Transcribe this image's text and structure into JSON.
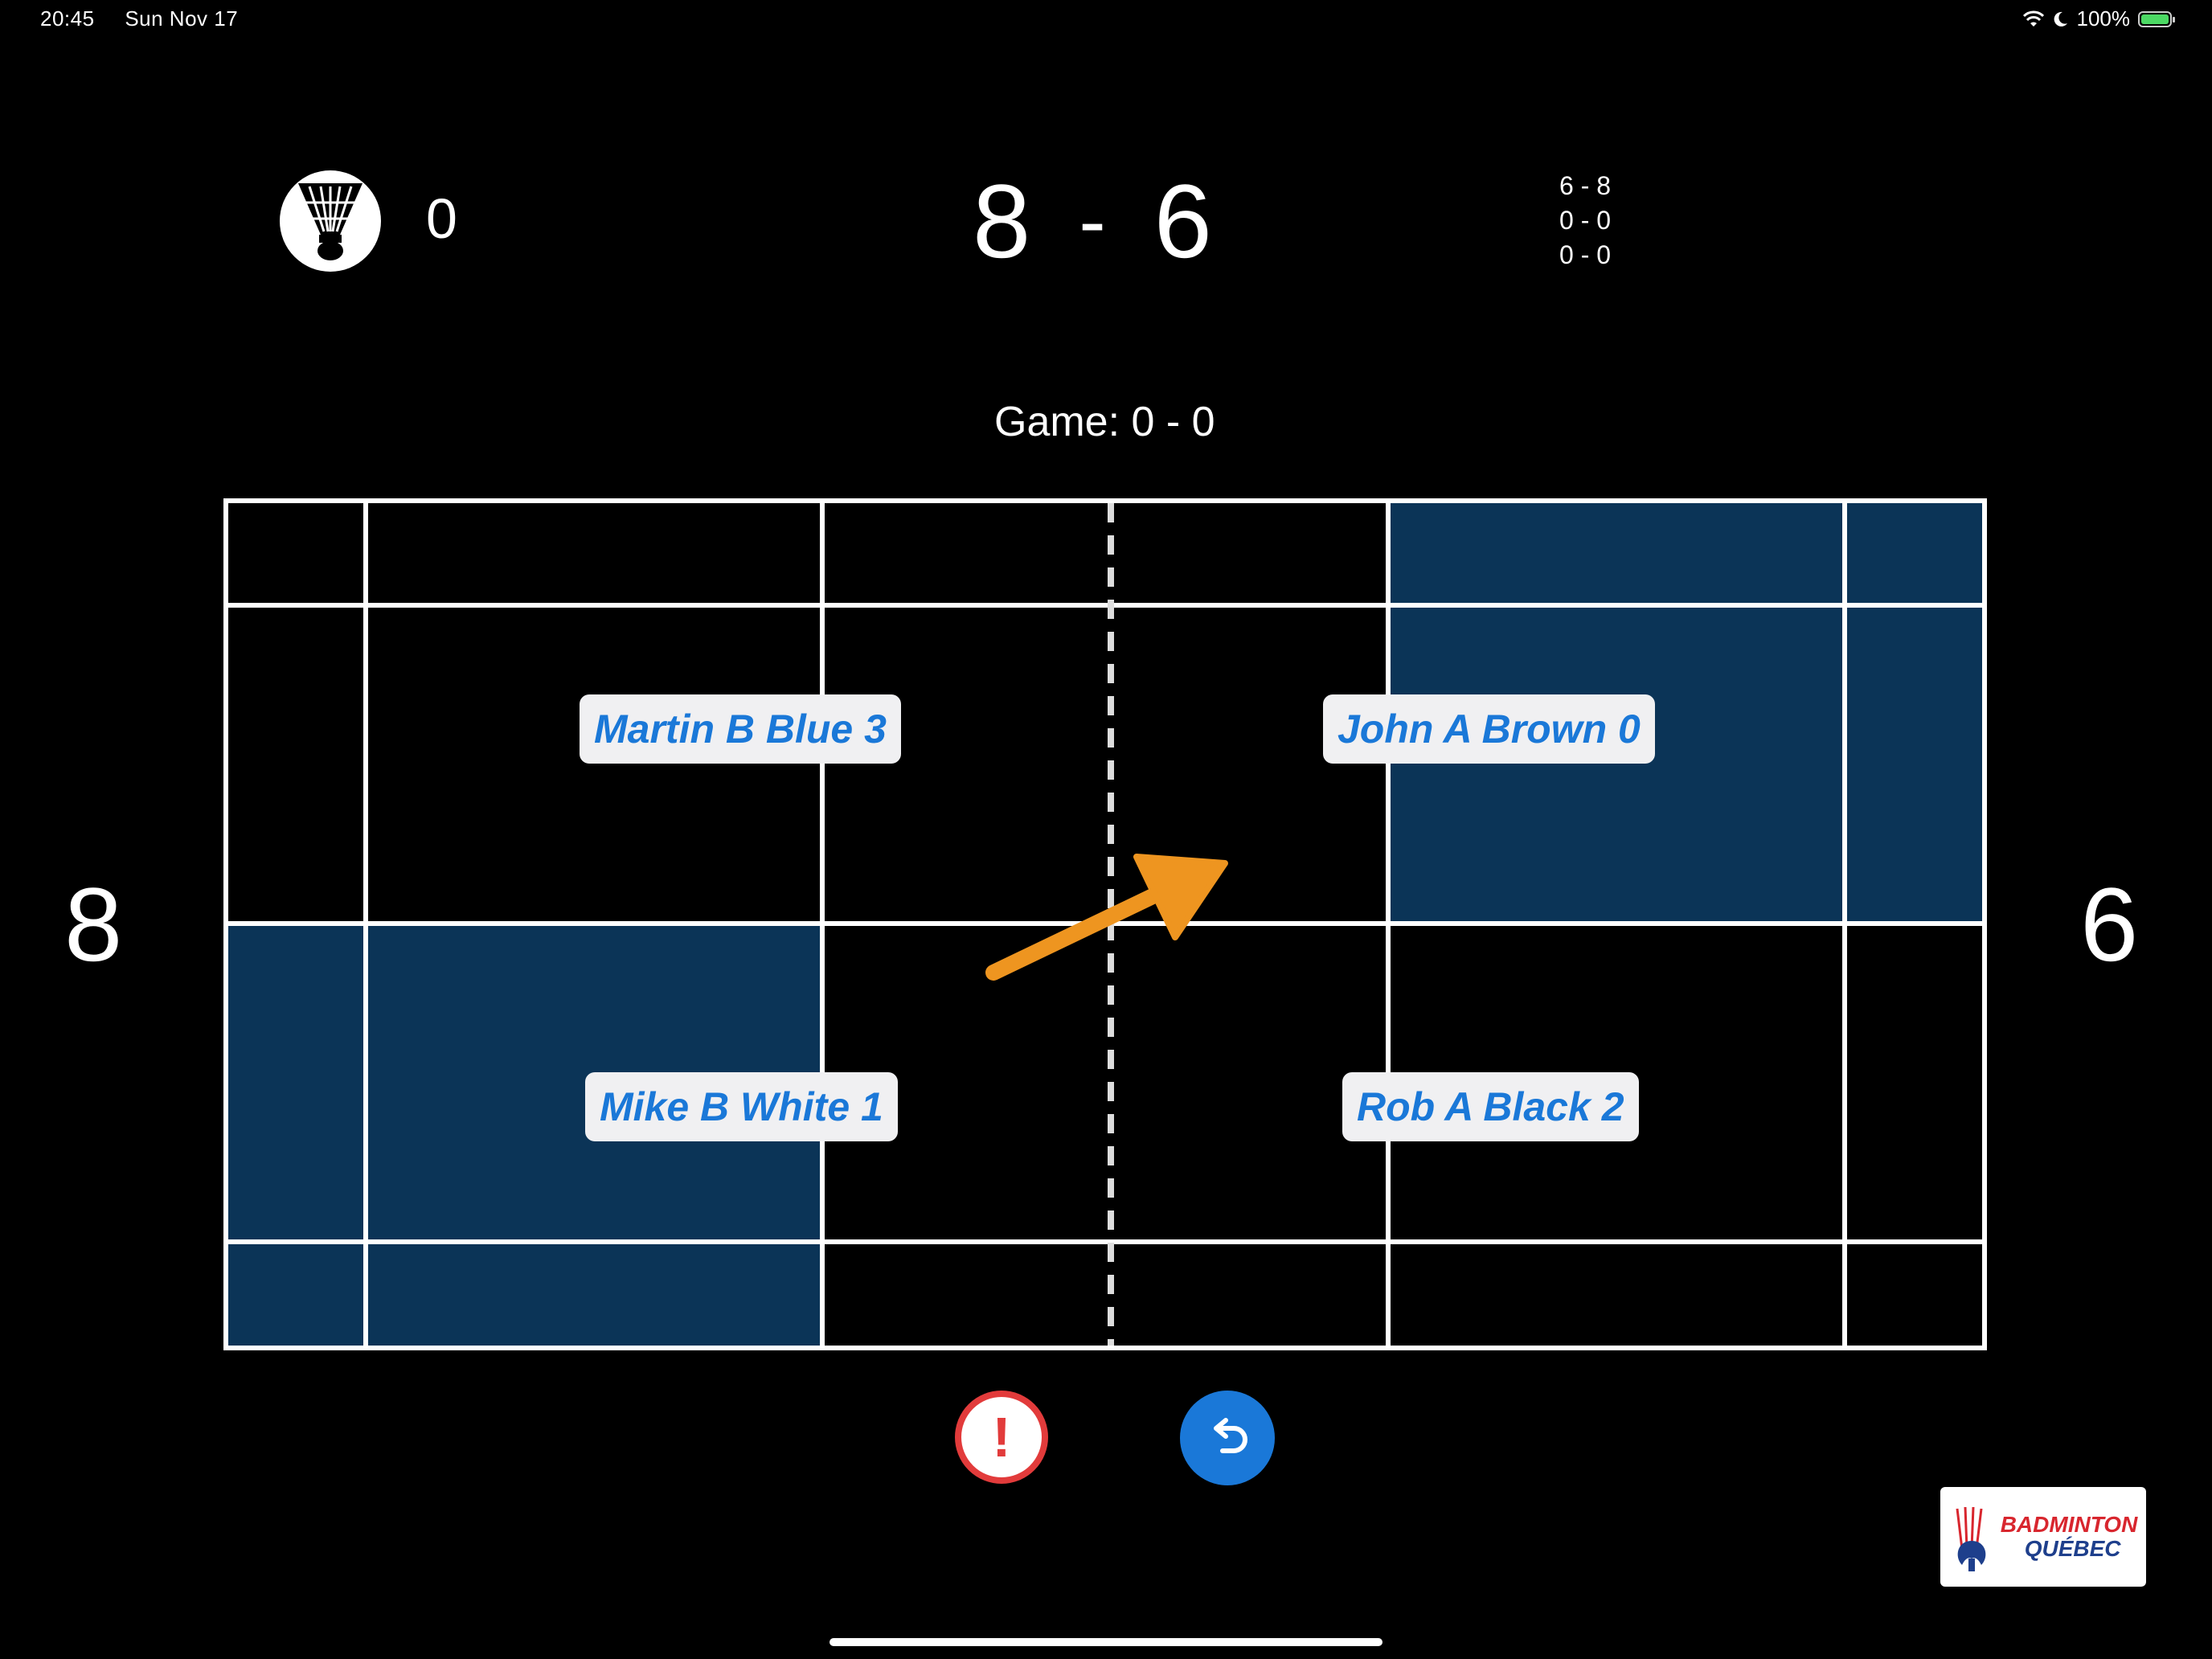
{
  "status_bar": {
    "time": "20:45",
    "date": "Sun Nov 17",
    "battery": "100%",
    "icons": [
      "wifi-icon",
      "moon-icon",
      "battery-charging-icon"
    ]
  },
  "header": {
    "shuttle_icon": "shuttlecock-icon",
    "shuttle_count": "0",
    "score_left": "8",
    "score_dash": "-",
    "score_right": "6",
    "set_scores": [
      "6 - 8",
      "0 - 0",
      "0 - 0"
    ],
    "game_label": "Game: 0 - 0"
  },
  "court": {
    "players": {
      "top_left": "Martin B Blue 3",
      "bottom_left": "Mike B White 1",
      "top_right": "John A Brown 0",
      "bottom_right": "Rob A Black 2"
    },
    "side_score_left": "8",
    "side_score_right": "6",
    "highlight_color": "#0b3457",
    "arrow_color": "#ee9520"
  },
  "controls": {
    "alert_icon": "exclamation-icon",
    "alert_symbol": "!",
    "undo_icon": "undo-arrow-icon"
  },
  "logo": {
    "line1": "BADMINTON",
    "line2": "QUÉBEC"
  }
}
